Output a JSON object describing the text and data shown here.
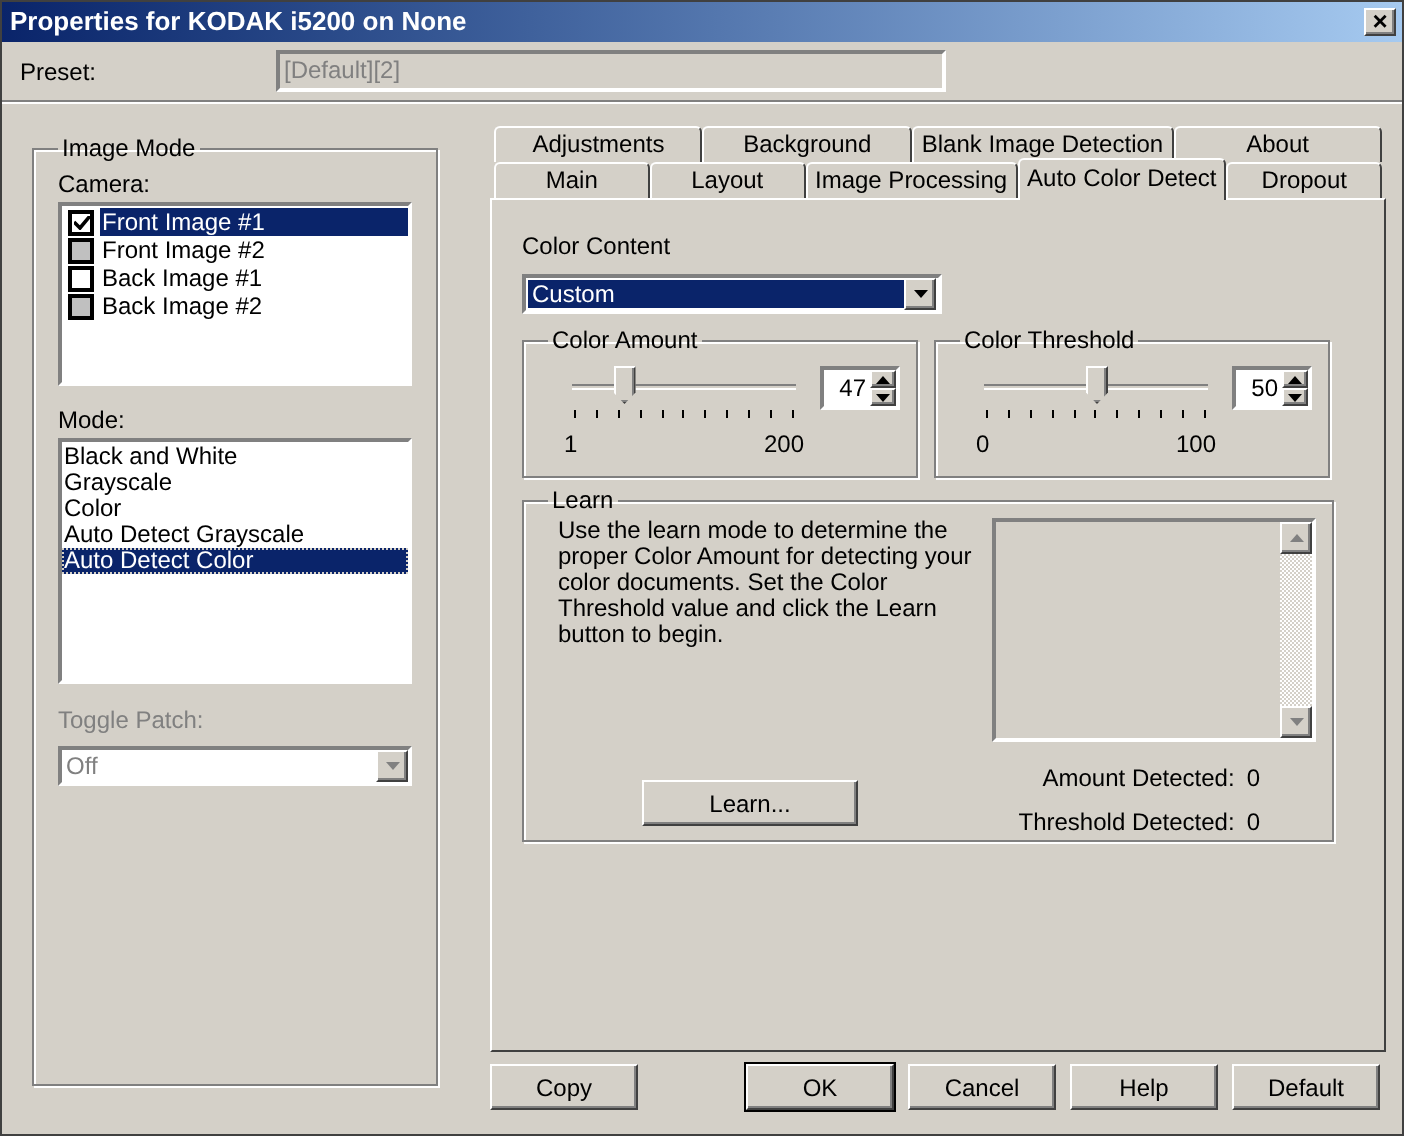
{
  "window": {
    "title": "Properties for KODAK i5200 on None",
    "close": "×"
  },
  "preset": {
    "label": "Preset:",
    "value": "[Default][2]"
  },
  "image_mode": {
    "title": "Image Mode",
    "camera_label": "Camera:",
    "cameras": [
      {
        "label": "Front Image #1",
        "checked": true,
        "disabled": false,
        "selected": true
      },
      {
        "label": "Front Image #2",
        "checked": false,
        "disabled": true,
        "selected": false
      },
      {
        "label": "Back Image #1",
        "checked": false,
        "disabled": false,
        "selected": false
      },
      {
        "label": "Back Image #2",
        "checked": false,
        "disabled": true,
        "selected": false
      }
    ],
    "mode_label": "Mode:",
    "modes": [
      {
        "label": "Black and White",
        "selected": false
      },
      {
        "label": "Grayscale",
        "selected": false
      },
      {
        "label": "Color",
        "selected": false
      },
      {
        "label": "Auto Detect Grayscale",
        "selected": false
      },
      {
        "label": "Auto Detect Color",
        "selected": true
      }
    ],
    "toggle_patch": {
      "label": "Toggle Patch:",
      "value": "Off",
      "disabled": true
    }
  },
  "tabs_back": [
    {
      "label": "Adjustments",
      "selected": false
    },
    {
      "label": "Background",
      "selected": false
    },
    {
      "label": "Blank Image Detection",
      "selected": false
    },
    {
      "label": "About",
      "selected": false
    }
  ],
  "tabs_front": [
    {
      "label": "Main",
      "selected": false
    },
    {
      "label": "Layout",
      "selected": false
    },
    {
      "label": "Image Processing",
      "selected": false
    },
    {
      "label": "Auto Color Detect",
      "selected": true
    },
    {
      "label": "Dropout",
      "selected": false
    }
  ],
  "color_content": {
    "label": "Color Content",
    "value": "Custom"
  },
  "sliders": [
    {
      "title": "Color Amount",
      "level": 0.23,
      "value": "47",
      "min": "1",
      "max": "200"
    },
    {
      "title": "Color Threshold",
      "level": 0.5,
      "value": "50",
      "min": "0",
      "max": "100"
    }
  ],
  "learn": {
    "title": "Learn",
    "text": "Use the learn mode to determine the proper Color Amount for detecting your color documents. Set the Color Threshold value and click the Learn button to begin.",
    "button": "Learn...",
    "amount_label": "Amount Detected:",
    "amount": "0",
    "threshold_label": "Threshold Detected:",
    "threshold": "0"
  },
  "buttons": [
    {
      "label": "Copy",
      "default": false
    },
    {
      "label": "OK",
      "default": true
    },
    {
      "label": "Cancel",
      "default": false
    },
    {
      "label": "Help",
      "default": false
    },
    {
      "label": "Default",
      "default": false
    }
  ]
}
